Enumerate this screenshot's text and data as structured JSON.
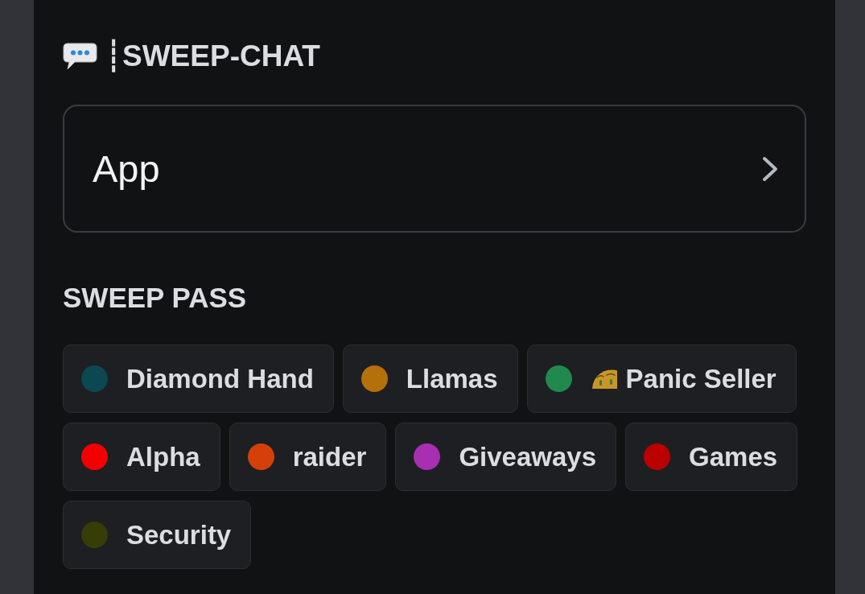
{
  "channel": {
    "title": "┊SWEEP-CHAT"
  },
  "link_card": {
    "label": "App"
  },
  "section": {
    "title": "SWEEP PASS"
  },
  "roles": [
    {
      "name": "Diamond Hand",
      "color": "#0b4852",
      "has_emoji": false
    },
    {
      "name": "Llamas",
      "color": "#b4700a",
      "has_emoji": false
    },
    {
      "name": "Panic Seller",
      "color": "#21894e",
      "has_emoji": true
    },
    {
      "name": "Alpha",
      "color": "#f20000",
      "has_emoji": false
    },
    {
      "name": "raider",
      "color": "#d5400a",
      "has_emoji": false
    },
    {
      "name": "Giveaways",
      "color": "#a82fb2",
      "has_emoji": false
    },
    {
      "name": "Games",
      "color": "#bb0000",
      "has_emoji": false
    },
    {
      "name": "Security",
      "color": "#363d06",
      "has_emoji": false
    }
  ]
}
